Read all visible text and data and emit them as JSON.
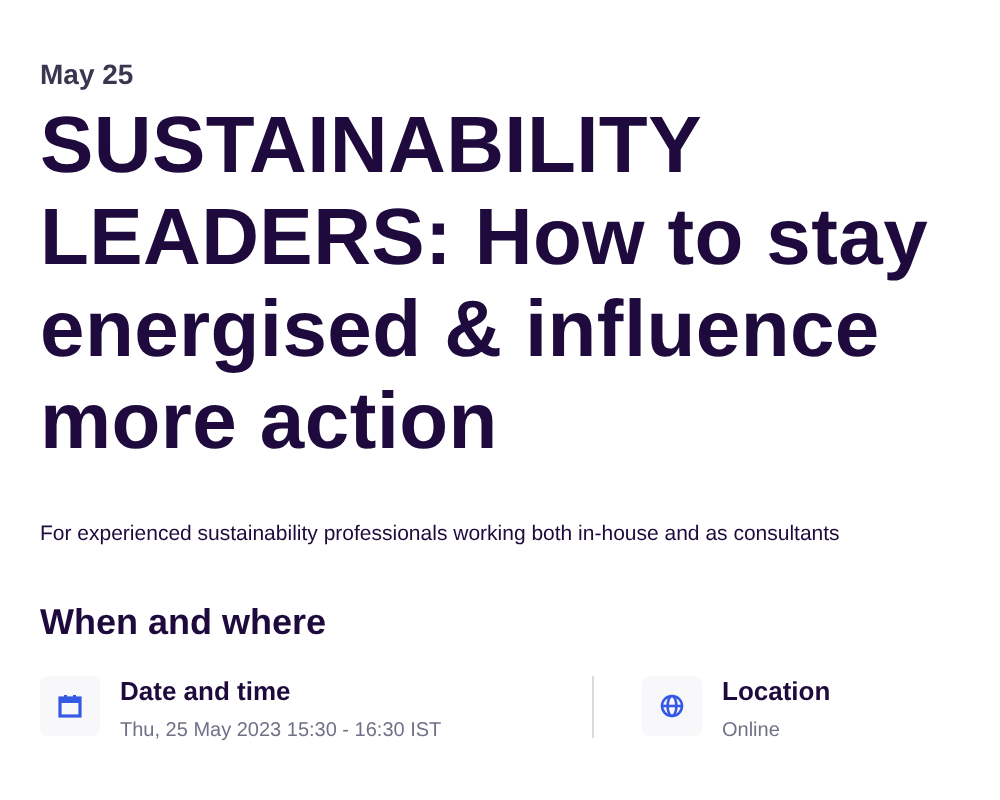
{
  "date": "May 25",
  "title": "SUSTAINABILITY LEADERS: How to stay energised & influence more action",
  "summary": "For experienced sustainability professionals working both in-house and as consultants",
  "section_title": "When and where",
  "details": [
    {
      "kind": "calendar",
      "label": "Date and time",
      "value": "Thu, 25 May 2023 15:30 - 16:30 IST"
    },
    {
      "kind": "globe",
      "label": "Location",
      "value": "Online"
    }
  ]
}
